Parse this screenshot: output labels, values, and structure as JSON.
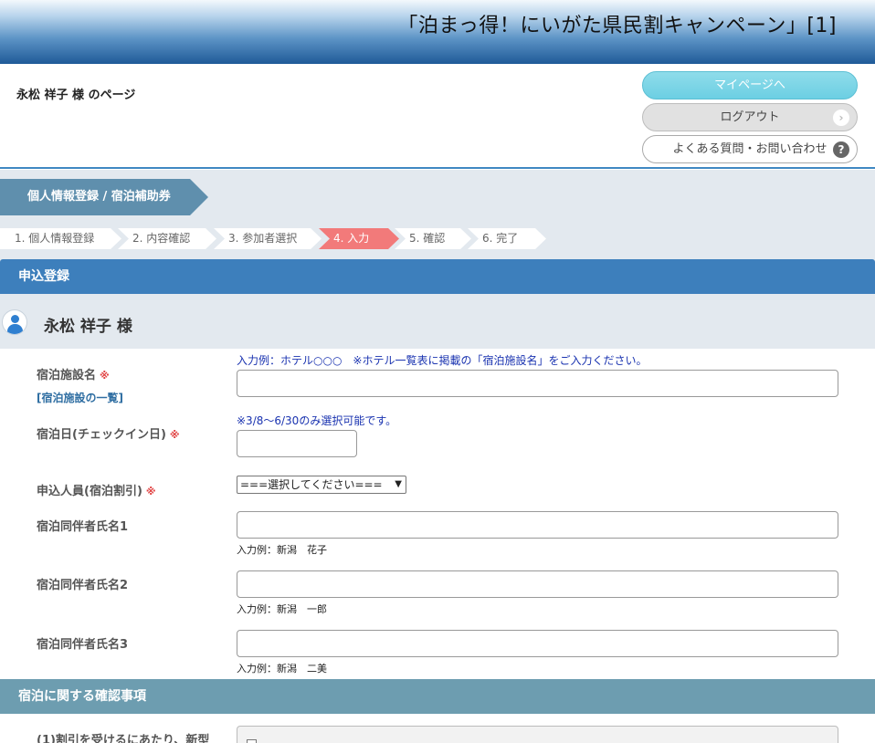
{
  "header": {
    "title": "「泊まっ得！にいがた県民割キャンペーン」[1]"
  },
  "user": {
    "page_label": "永松 祥子 様 のページ"
  },
  "buttons": {
    "mypage": "マイページへ",
    "logout": "ログアウト",
    "faq": "よくある質問・お問い合わせ"
  },
  "breadcrumb": {
    "label": "個人情報登録 / 宿泊補助券"
  },
  "steps": [
    {
      "label": "1. 個人情報登録"
    },
    {
      "label": "2. 内容確認"
    },
    {
      "label": "3. 参加者選択"
    },
    {
      "label": "4. 入力"
    },
    {
      "label": "5. 確認"
    },
    {
      "label": "6. 完了"
    }
  ],
  "active_step": 4,
  "section_apply": "申込登録",
  "applicant_name": "永松 祥子 様",
  "form": {
    "facility": {
      "label": "宿泊施設名",
      "required": "※",
      "link": "[宿泊施設の一覧]",
      "hint": "入力例：ホテル○○○　※ホテル一覧表に掲載の「宿泊施設名」をご入力ください。",
      "value": ""
    },
    "checkin": {
      "label": "宿泊日(チェックイン日)",
      "required": "※",
      "hint": "※3/8～6/30のみ選択可能です。",
      "value": ""
    },
    "persons": {
      "label": "申込人員(宿泊割引)",
      "required": "※",
      "selected": "===選択してください==="
    },
    "companion1": {
      "label": "宿泊同伴者氏名1",
      "example": "入力例：新潟　花子",
      "value": ""
    },
    "companion2": {
      "label": "宿泊同伴者氏名2",
      "example": "入力例：新潟　一郎",
      "value": ""
    },
    "companion3": {
      "label": "宿泊同伴者氏名3",
      "example": "入力例：新潟　二美",
      "value": ""
    }
  },
  "section_confirm": "宿泊に関する確認事項",
  "confirm_item1": {
    "label": "(1)割引を受けるにあたり、新型"
  },
  "colors": {
    "header_dark": "#1f5a98",
    "section_blue": "#3d7fbc",
    "section_teal": "#6d9db0",
    "active_step": "#f27a7a",
    "required_mark": "#e04040",
    "hint_text": "#1a33b0"
  }
}
